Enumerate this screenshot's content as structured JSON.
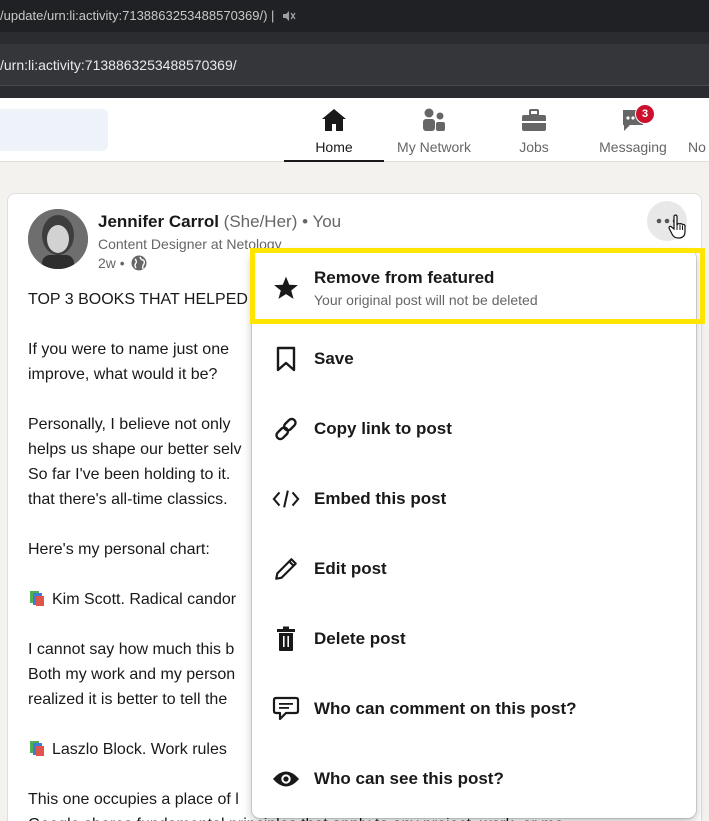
{
  "browser": {
    "title": "/update/urn:li:activity:7138863253488570369/) |",
    "url": "/urn:li:activity:7138863253488570369/"
  },
  "nav": {
    "items": [
      {
        "label": "Home",
        "icon": "home-icon",
        "active": true
      },
      {
        "label": "My Network",
        "icon": "network-icon",
        "active": false
      },
      {
        "label": "Jobs",
        "icon": "briefcase-icon",
        "active": false
      },
      {
        "label": "Messaging",
        "icon": "messaging-icon",
        "active": false,
        "badge": "3"
      },
      {
        "label": "No",
        "icon": "notifications-icon",
        "active": false
      }
    ]
  },
  "post": {
    "author_name": "Jennifer Carrol",
    "author_suffix": "(She/Her) • You",
    "headline": "Content Designer at Netology",
    "time": "2w •",
    "lines": [
      "TOP 3 BOOKS THAT HELPED",
      "",
      "If you were to name just one",
      "improve, what would it be?",
      "",
      "Personally, I believe not only",
      "helps us shape our better selv",
      "So far I've been holding to it.",
      "that there's all-time classics.",
      "",
      "Here's my personal chart:",
      "",
      "Kim Scott. Radical candor",
      "",
      "I cannot say how much this b",
      "Both my work and my person",
      "realized it is better to tell the",
      "",
      "Laszlo Block. Work rules",
      "",
      "This one occupies a place of l",
      "Google shares fundamental principles that apply to any project, work, or mo"
    ]
  },
  "menu": {
    "items": [
      {
        "label": "Remove from featured",
        "sublabel": "Your original post will not be deleted",
        "icon": "star-icon"
      },
      {
        "label": "Save",
        "icon": "bookmark-icon"
      },
      {
        "label": "Copy link to post",
        "icon": "link-icon"
      },
      {
        "label": "Embed this post",
        "icon": "code-icon"
      },
      {
        "label": "Edit post",
        "icon": "pencil-icon"
      },
      {
        "label": "Delete post",
        "icon": "trash-icon"
      },
      {
        "label": "Who can comment on this post?",
        "icon": "comment-icon"
      },
      {
        "label": "Who can see this post?",
        "icon": "eye-icon"
      }
    ]
  },
  "colors": {
    "highlight": "#ffe500",
    "badge": "#cb112d"
  }
}
